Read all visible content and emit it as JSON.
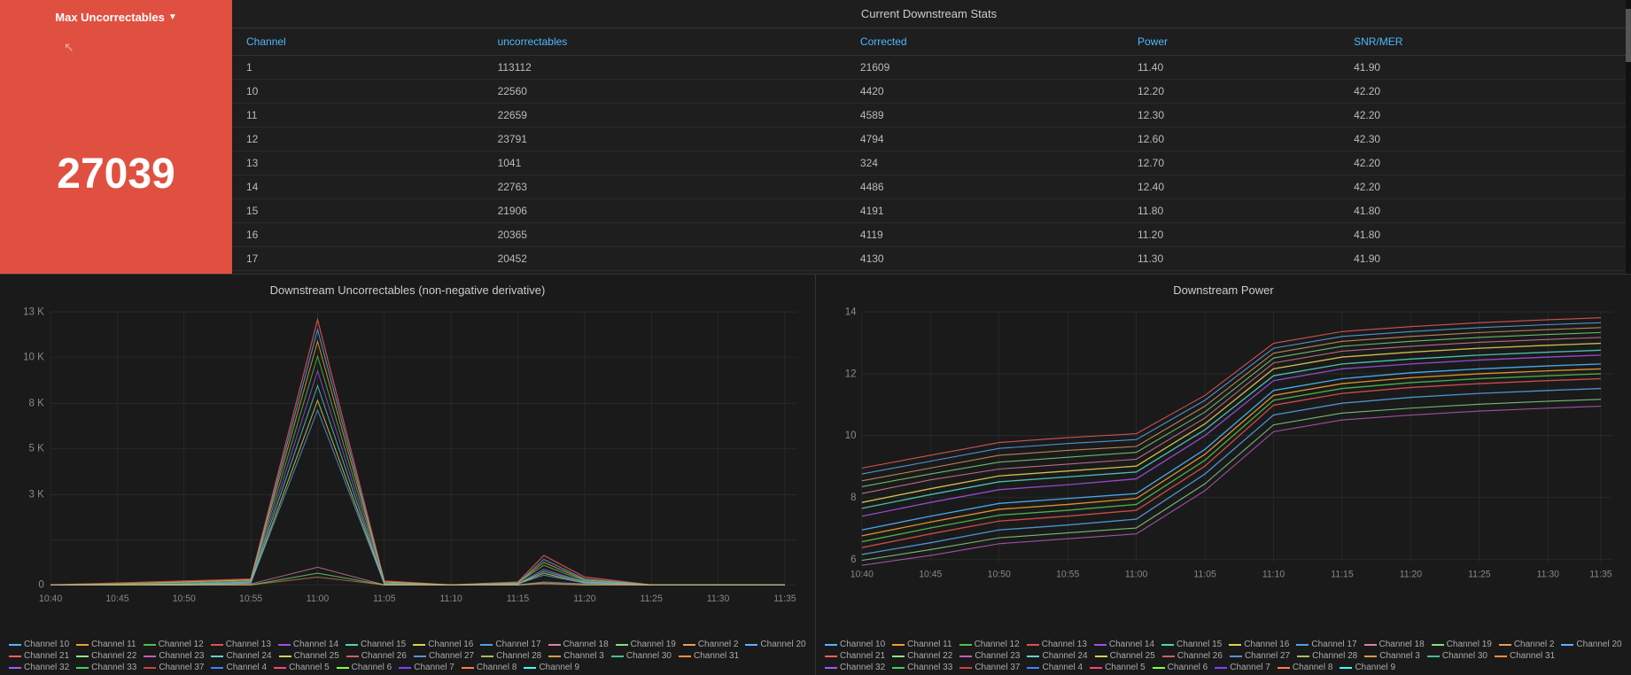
{
  "maxUncorrectables": {
    "title": "Max Uncorrectables",
    "value": "27039",
    "arrow": "▼"
  },
  "table": {
    "title": "Current Downstream Stats",
    "columns": [
      "Channel",
      "uncorrectables",
      "Corrected",
      "Power",
      "SNR/MER"
    ],
    "rows": [
      {
        "channel": "1",
        "uncorrectables": "113112",
        "corrected": "21609",
        "power": "11.40",
        "snr": "41.90"
      },
      {
        "channel": "10",
        "uncorrectables": "22560",
        "corrected": "4420",
        "power": "12.20",
        "snr": "42.20"
      },
      {
        "channel": "11",
        "uncorrectables": "22659",
        "corrected": "4589",
        "power": "12.30",
        "snr": "42.20"
      },
      {
        "channel": "12",
        "uncorrectables": "23791",
        "corrected": "4794",
        "power": "12.60",
        "snr": "42.30"
      },
      {
        "channel": "13",
        "uncorrectables": "1041",
        "corrected": "324",
        "power": "12.70",
        "snr": "42.20"
      },
      {
        "channel": "14",
        "uncorrectables": "22763",
        "corrected": "4486",
        "power": "12.40",
        "snr": "42.20"
      },
      {
        "channel": "15",
        "uncorrectables": "21906",
        "corrected": "4191",
        "power": "11.80",
        "snr": "41.80"
      },
      {
        "channel": "16",
        "uncorrectables": "20365",
        "corrected": "4119",
        "power": "11.20",
        "snr": "41.80"
      },
      {
        "channel": "17",
        "uncorrectables": "20452",
        "corrected": "4130",
        "power": "11.30",
        "snr": "41.90"
      }
    ]
  },
  "charts": {
    "uncorrectables": {
      "title": "Downstream Uncorrectables (non-negative derivative)",
      "yLabels": [
        "0",
        "3 K",
        "5 K",
        "8 K",
        "10 K",
        "13 K"
      ],
      "xLabels": [
        "10:40",
        "10:45",
        "10:50",
        "10:55",
        "11:00",
        "11:05",
        "11:10",
        "11:15",
        "11:20",
        "11:25",
        "11:30",
        "11:35"
      ]
    },
    "power": {
      "title": "Downstream Power",
      "yLabels": [
        "6",
        "8",
        "10",
        "12",
        "14"
      ],
      "xLabels": [
        "10:40",
        "10:45",
        "10:50",
        "10:55",
        "11:00",
        "11:05",
        "11:10",
        "11:15",
        "11:20",
        "11:25",
        "11:30",
        "11:35"
      ]
    }
  },
  "legend": {
    "items": [
      {
        "label": "Channel 10",
        "color": "#4db8ff"
      },
      {
        "label": "Channel 11",
        "color": "#f0a030"
      },
      {
        "label": "Channel 12",
        "color": "#50c050"
      },
      {
        "label": "Channel 13",
        "color": "#e05050"
      },
      {
        "label": "Channel 14",
        "color": "#a050e0"
      },
      {
        "label": "Channel 15",
        "color": "#50d0c0"
      },
      {
        "label": "Channel 16",
        "color": "#e0d050"
      },
      {
        "label": "Channel 17",
        "color": "#50a0e0"
      },
      {
        "label": "Channel 18",
        "color": "#e080a0"
      },
      {
        "label": "Channel 19",
        "color": "#80e080"
      },
      {
        "label": "Channel 2",
        "color": "#e0a060"
      },
      {
        "label": "Channel 20",
        "color": "#60b0ff"
      },
      {
        "label": "Channel 21",
        "color": "#ff6060"
      },
      {
        "label": "Channel 22",
        "color": "#90e090"
      },
      {
        "label": "Channel 23",
        "color": "#c060c0"
      },
      {
        "label": "Channel 24",
        "color": "#60d0d0"
      },
      {
        "label": "Channel 25",
        "color": "#d0d060"
      },
      {
        "label": "Channel 26",
        "color": "#d06060"
      },
      {
        "label": "Channel 27",
        "color": "#6090d0"
      },
      {
        "label": "Channel 28",
        "color": "#a0c060"
      },
      {
        "label": "Channel 3",
        "color": "#d0a040"
      },
      {
        "label": "Channel 30",
        "color": "#40c0a0"
      },
      {
        "label": "Channel 31",
        "color": "#ff9040"
      },
      {
        "label": "Channel 32",
        "color": "#9060ff"
      },
      {
        "label": "Channel 33",
        "color": "#40d060"
      },
      {
        "label": "Channel 37",
        "color": "#d04040"
      },
      {
        "label": "Channel 4",
        "color": "#4080ff"
      },
      {
        "label": "Channel 5",
        "color": "#ff4080"
      },
      {
        "label": "Channel 6",
        "color": "#80ff40"
      },
      {
        "label": "Channel 7",
        "color": "#8040ff"
      },
      {
        "label": "Channel 8",
        "color": "#ff8040"
      },
      {
        "label": "Channel 9",
        "color": "#40ffff"
      }
    ]
  }
}
